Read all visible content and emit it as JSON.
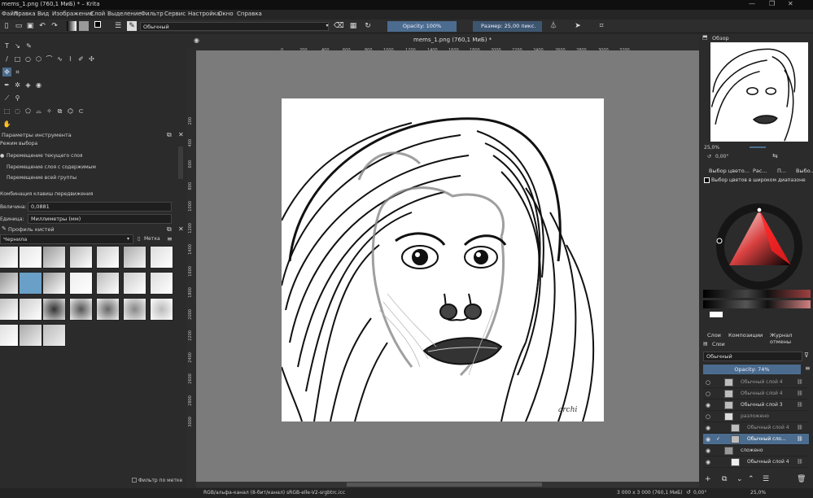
{
  "window": {
    "title": "mems_1.png (760,1 МиБ) * – Krita",
    "controls": [
      "—",
      "❐",
      "✕"
    ]
  },
  "menu": [
    "Файл",
    "Правка",
    "Вид",
    "Изображение",
    "Слой",
    "Выделение",
    "Фильтр",
    "Сервис",
    "Настройка",
    "Окно",
    "Справка"
  ],
  "toolbar": {
    "blend_mode": "Обычный",
    "opacity": "Opacity: 100%",
    "size": "Размер: 25,00 пикс."
  },
  "tool_options": {
    "title": "Параметры инструмента",
    "mode_label": "Режим выбора",
    "modes": [
      "Перемещение текущего слоя",
      "Перемещение слоя с содержимым",
      "Перемещение всей группы"
    ],
    "shortcut_label": "Комбинация клавиш передвижения",
    "amount_label": "Величина:",
    "amount_value": "0,0881",
    "unit_label": "Единица:",
    "unit_value": "Миллиметры (мм)"
  },
  "brush_presets": {
    "title": "Профиль кистей",
    "filter": "Чернила",
    "tag_label": "Метка",
    "filter_by_tag": "Фильтр по метке"
  },
  "document": {
    "tab_title": "mems_1.png (760,1 МиБ) *",
    "signature": "archi"
  },
  "ruler": {
    "h": [
      "0",
      "200",
      "400",
      "600",
      "800",
      "1000",
      "1200",
      "1400",
      "1600",
      "1800",
      "2000",
      "2200",
      "2400",
      "2600",
      "2800",
      "3000",
      "3200"
    ],
    "v": [
      "200",
      "400",
      "600",
      "800",
      "1000",
      "1200",
      "1400",
      "1600",
      "1800",
      "2000",
      "2200",
      "2400",
      "2600",
      "2800",
      "3000"
    ]
  },
  "overview": {
    "title": "Обзор",
    "zoom": "25,0%",
    "rotation": "0,00°"
  },
  "color_selector": {
    "tabs": [
      "Выбор цвето...",
      "Рас...",
      "П...",
      "Выбо..."
    ],
    "title": "Выбор цветов в широком диапазоне"
  },
  "layers": {
    "tabs": [
      "Слои",
      "Композиции",
      "Журнал отмены"
    ],
    "panel_title": "Слои",
    "blend_mode": "Обычный",
    "opacity": "Opacity: 74%",
    "rows": [
      {
        "name": "Обычный слой 4",
        "dim": true
      },
      {
        "name": "Обычный слой 4",
        "dim": true
      },
      {
        "name": "Обычный слой 3",
        "dim": false
      },
      {
        "name": "разложено",
        "dim": true
      },
      {
        "name": "Обычный слой 4",
        "dim": true
      },
      {
        "name": "Обычный сло...",
        "dim": false,
        "selected": true
      },
      {
        "name": "сложено",
        "dim": false
      },
      {
        "name": "Обычный слой 4",
        "dim": false
      }
    ]
  },
  "statusbar": {
    "color_info": "RGB/альфа-канал (8-бит/канал)  sRGB-elle-V2-srgbtrc.icc",
    "size_info": "3 000 x 3 000 (760,1 МиБ)",
    "rotation": "0,00°",
    "zoom": "25,0%"
  },
  "colors": {
    "accent": "#4b6c8f",
    "canvas_bg": "#7b7b7b"
  }
}
